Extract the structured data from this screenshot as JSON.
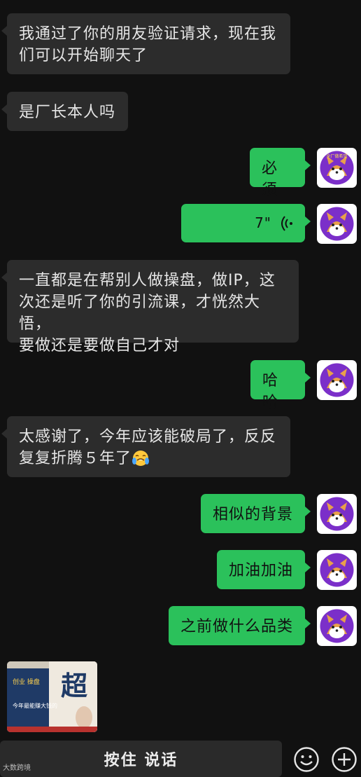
{
  "messages": [
    {
      "side": "left",
      "text": "我通过了你的朋友验证请求，现在我们可以开始聊天了"
    },
    {
      "side": "left",
      "text": "是厂长本人吗"
    },
    {
      "side": "right",
      "text": "必须"
    },
    {
      "side": "right",
      "type": "voice",
      "duration": "7\""
    },
    {
      "side": "left",
      "text": "一直都是在帮别人做操盘，做IP，这次还是听了你的引流课，才恍然大悟，要做还是要做自己才对"
    },
    {
      "side": "right",
      "text": "哈哈"
    },
    {
      "side": "left",
      "text": "太感谢了，今年应该能破局了，反反复复折腾５年了😭"
    },
    {
      "side": "right",
      "text": "相似的背景"
    },
    {
      "side": "right",
      "text": "加油加油"
    },
    {
      "side": "right",
      "text": "之前做什么品类"
    }
  ],
  "msg_lines": {
    "m0": [
      "我通过了你的朋友验证请求，现在我",
      "们可以开始聊天了"
    ],
    "m4": [
      "一直都是在帮别人做操盘，做IP，这",
      "次还是听了你的引流课，才恍然大悟，",
      "要做还是要做自己才对"
    ],
    "m6a": "太感谢了，今年应该能破局了，反反",
    "m6b": "复复折腾５年了"
  },
  "image_message": {
    "book_title": "超",
    "book_subtitle": "今年最能赚大钱的",
    "tag": "创业 操盘"
  },
  "avatar": {
    "text": "全厂做希望",
    "icon": "shiba-dog-avatar"
  },
  "input_bar": {
    "talk_label": "按住 说话",
    "emoji_icon": "smiley-face-icon",
    "add_icon": "plus-circle-icon"
  },
  "watermark": "大数跨境",
  "colors": {
    "background": "#111111",
    "bubble_left": "#2c2c2c",
    "bubble_right": "#2bc15b",
    "avatar_purple": "#7b2fc9"
  }
}
